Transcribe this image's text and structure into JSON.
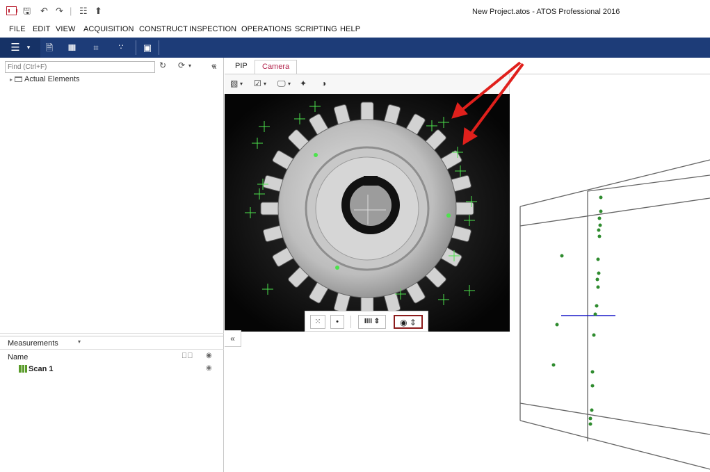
{
  "window": {
    "title": "New Project.atos - ATOS Professional 2016"
  },
  "quick_access": {
    "save_icon": "save-icon",
    "undo_icon": "undo-icon",
    "redo_icon": "redo-icon",
    "network_icon": "network-icon",
    "export_icon": "export-icon"
  },
  "menu": {
    "items": [
      "FILE",
      "EDIT",
      "VIEW",
      "ACQUISITION",
      "CONSTRUCT",
      "INSPECTION",
      "OPERATIONS",
      "SCRIPTING",
      "HELP"
    ]
  },
  "toolbar": {
    "icons": [
      "hamburger-icon",
      "add-element-icon",
      "bars-icon",
      "crop-icon",
      "points-icon",
      "checker-icon"
    ],
    "color": "#1d3c78"
  },
  "explorer": {
    "search_placeholder": "Find (Ctrl+F)",
    "tree": [
      {
        "label": "Actual Elements"
      }
    ]
  },
  "measurements": {
    "title": "Measurements",
    "columns": {
      "name": "Name"
    },
    "rows": [
      {
        "name": "Scan 1"
      }
    ]
  },
  "view": {
    "tabs": [
      {
        "label": "PIP",
        "active": false
      },
      {
        "label": "Camera",
        "active": true
      }
    ],
    "accent_color": "#b2224a"
  },
  "camera_overlay": {
    "buttons": [
      "grid-dots-icon",
      "single-dot-icon",
      "stripes-stepper",
      "ring-stepper"
    ]
  },
  "annotation": {
    "arrow_color": "#e0201c"
  }
}
